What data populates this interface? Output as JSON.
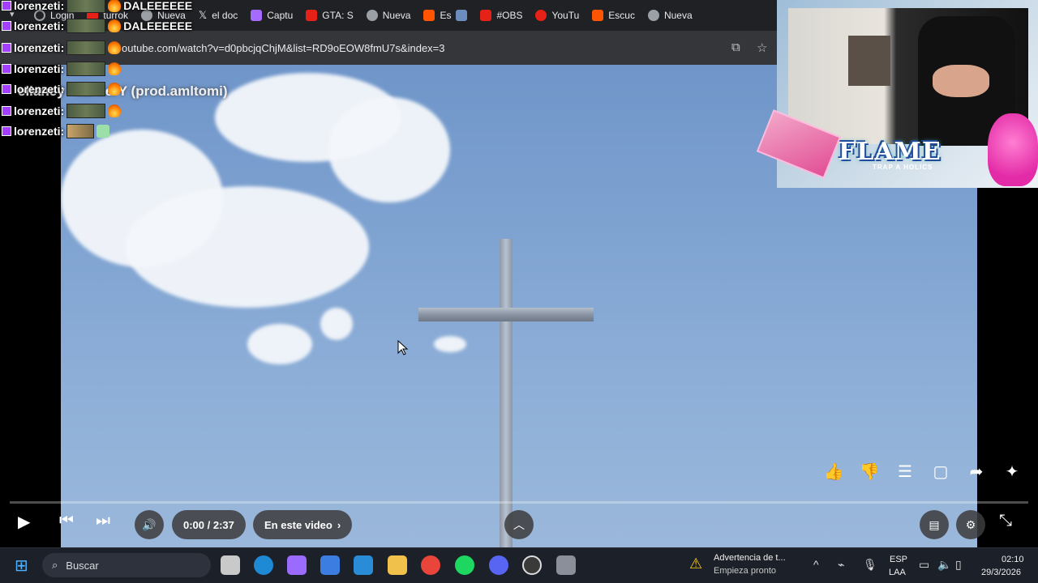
{
  "browser": {
    "tabs": [
      {
        "label": "Login",
        "color": "#7aa0ff",
        "icon": "reload-icon"
      },
      {
        "label": "turrok",
        "color": "#e62117",
        "icon": "youtube-icon"
      },
      {
        "label": "Nueva",
        "color": "#9aa0a6",
        "icon": "chrome-icon"
      },
      {
        "label": "el doc",
        "color": "#ffffff",
        "icon": "x-icon"
      },
      {
        "label": "Captu",
        "color": "#a56bff",
        "icon": "pen-icon"
      },
      {
        "label": "GTA: S",
        "color": "#e62117",
        "icon": "youtube-icon"
      },
      {
        "label": "Nueva",
        "color": "#9aa0a6",
        "icon": "chrome-icon"
      },
      {
        "label": "Es",
        "color": "#ff5500",
        "icon": "soundcloud-icon"
      },
      {
        "label": "#OBS",
        "color": "#e62117",
        "icon": "youtube-icon"
      },
      {
        "label": "YouTu",
        "color": "#e62117",
        "icon": "youtube-icon"
      },
      {
        "label": "Escuc",
        "color": "#ff5500",
        "icon": "soundcloud-icon"
      },
      {
        "label": "Nueva",
        "color": "#9aa0a6",
        "icon": "chrome-icon"
      }
    ],
    "url": "outube.com/watch?v=d0pbcjqChjM&list=RD9oEOW8fmU7s&index=3"
  },
  "chat": {
    "messages": [
      {
        "user": "lorenzeti:",
        "text": "DALEEEEEE"
      },
      {
        "user": "lorenzeti:",
        "text": "DALEEEEEE"
      },
      {
        "user": "lorenzeti:",
        "text": ""
      },
      {
        "user": "lorenzeti:",
        "text": ""
      },
      {
        "user": "lorenzeti:",
        "text": ""
      },
      {
        "user": "lorenzeti:",
        "text": ""
      },
      {
        "user": "lorenzeti:",
        "text": ""
      }
    ]
  },
  "video": {
    "title": "ellaney - mi ñerY (prod.amltomi)"
  },
  "overlay": {
    "brand": "FLAME",
    "brand_sub": "TRAP A HOLICS"
  },
  "player": {
    "time": "0:00 / 2:37",
    "chapters_label": "En este video",
    "progress": 0
  },
  "taskbar": {
    "search_placeholder": "Buscar",
    "notification_title": "Advertencia de t...",
    "notification_sub": "Empieza pronto",
    "lang1": "ESP",
    "lang2": "LAA",
    "time": "02:10",
    "date": "29/3/2026"
  }
}
